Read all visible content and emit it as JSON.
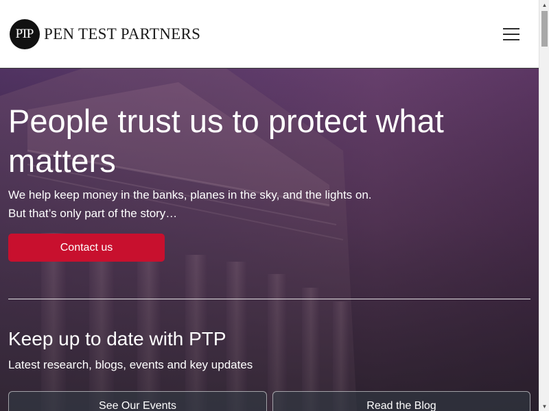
{
  "header": {
    "logo_mark": "PTP",
    "logo_text": "PEN TEST PARTNERS",
    "menu_icon": "hamburger-menu-icon"
  },
  "hero": {
    "title": "People trust us to protect what matters",
    "lead_line1": "We help keep money in the banks, planes in the sky, and the lights on.",
    "lead_line2": "But that’s only part of the story…",
    "contact_label": "Contact us",
    "accent_color": "#c8102e"
  },
  "updates": {
    "title": "Keep up to date with PTP",
    "subtitle": "Latest research, blogs, events and key updates",
    "events_label": "See Our Events",
    "blog_label": "Read the Blog"
  },
  "scrollbar": {
    "up_icon": "scroll-up-arrow-icon",
    "down_icon": "scroll-down-arrow-icon"
  }
}
